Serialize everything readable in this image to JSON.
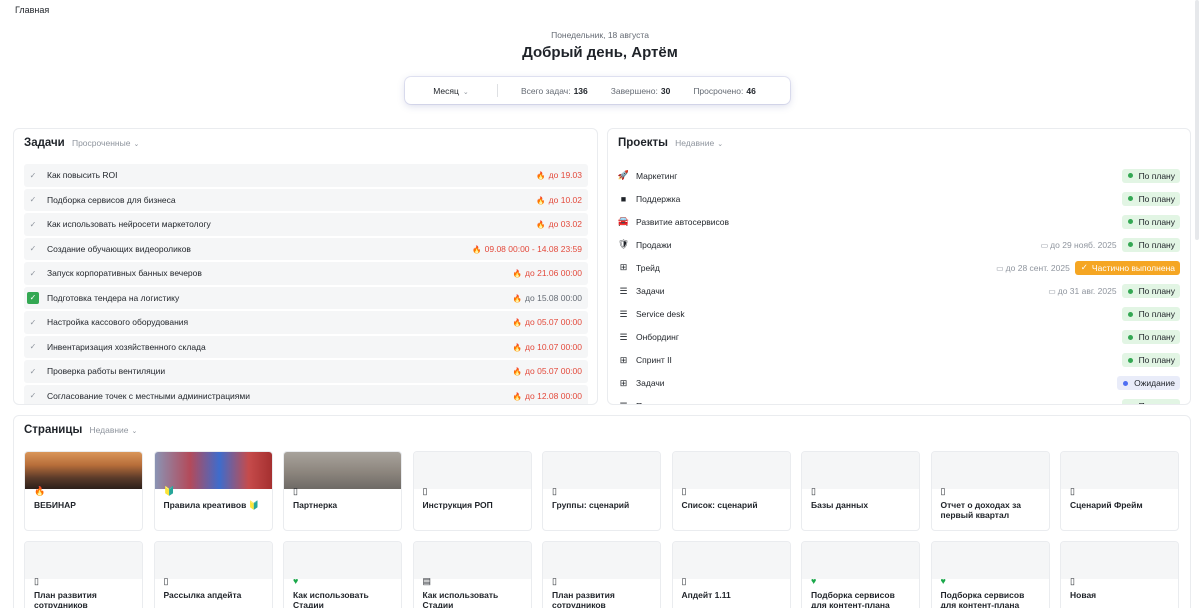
{
  "breadcrumb": "Главная",
  "header": {
    "date": "Понедельник, 18 августа",
    "greeting": "Добрый день, Артём"
  },
  "stats": {
    "period": "Месяц",
    "total_label": "Всего задач:",
    "total_value": "136",
    "done_label": "Завершено:",
    "done_value": "30",
    "overdue_label": "Просрочено:",
    "overdue_value": "46"
  },
  "tasks": {
    "title": "Задачи",
    "filter": "Просроченные",
    "items": [
      {
        "name": "Как повысить ROI",
        "due": "до 19.03",
        "done": false,
        "color": "#e3493b"
      },
      {
        "name": "Подборка сервисов для бизнеса",
        "due": "до 10.02",
        "done": false,
        "color": "#e3493b"
      },
      {
        "name": "Как использовать нейросети маркетологу",
        "due": "до 03.02",
        "done": false,
        "color": "#e3493b"
      },
      {
        "name": "Создание обучающих видеороликов",
        "due": "09.08 00:00 - 14.08 23:59",
        "done": false,
        "color": "#e3493b"
      },
      {
        "name": "Запуск корпоративных банных вечеров",
        "due": "до 21.06 00:00",
        "done": false,
        "color": "#e3493b"
      },
      {
        "name": "Подготовка тендера на логистику",
        "due": "до 15.08 00:00",
        "done": true,
        "color": "#646a73"
      },
      {
        "name": "Настройка кассового оборудования",
        "due": "до 05.07 00:00",
        "done": false,
        "color": "#e3493b"
      },
      {
        "name": "Инвентаризация хозяйственного склада",
        "due": "до 10.07 00:00",
        "done": false,
        "color": "#e3493b"
      },
      {
        "name": "Проверка работы вентиляции",
        "due": "до 05.07 00:00",
        "done": false,
        "color": "#e3493b"
      },
      {
        "name": "Согласование точек с местными администрациями",
        "due": "до 12.08 00:00",
        "done": false,
        "color": "#e3493b"
      }
    ]
  },
  "projects": {
    "title": "Проекты",
    "filter": "Недавние",
    "items": [
      {
        "icon": "rocket-icon",
        "glyph": "🚀",
        "name": "Маркетинг",
        "date": "",
        "status": "По плану",
        "kind": "ok"
      },
      {
        "icon": "support-icon",
        "glyph": "■",
        "name": "Поддержка",
        "date": "",
        "status": "По плану",
        "kind": "ok"
      },
      {
        "icon": "car-icon",
        "glyph": "🚘",
        "name": "Развитие автосервисов",
        "date": "",
        "status": "По плану",
        "kind": "ok"
      },
      {
        "icon": "shield-icon",
        "glyph": "🛡",
        "name": "Продажи",
        "date": "до 29 нояб. 2025",
        "status": "По плану",
        "kind": "ok"
      },
      {
        "icon": "kanban-icon",
        "glyph": "⊞",
        "name": "Трейд",
        "date": "до 28 сент. 2025",
        "status": "Частично выполнена",
        "kind": "partial"
      },
      {
        "icon": "list-icon",
        "glyph": "☰",
        "name": "Задачи",
        "date": "до 31 авг. 2025",
        "status": "По плану",
        "kind": "ok"
      },
      {
        "icon": "list-icon",
        "glyph": "☰",
        "name": "Service desk",
        "date": "",
        "status": "По плану",
        "kind": "ok"
      },
      {
        "icon": "list-icon",
        "glyph": "☰",
        "name": "Онбординг",
        "date": "",
        "status": "По плану",
        "kind": "ok"
      },
      {
        "icon": "kanban-icon",
        "glyph": "⊞",
        "name": "Спринт II",
        "date": "",
        "status": "По плану",
        "kind": "ok"
      },
      {
        "icon": "kanban-icon",
        "glyph": "⊞",
        "name": "Задачи",
        "date": "",
        "status": "Ожидание",
        "kind": "wait"
      },
      {
        "icon": "list-icon",
        "glyph": "☰",
        "name": "Проектные документы",
        "date": "",
        "status": "По плану",
        "kind": "ok"
      }
    ]
  },
  "pages": {
    "title": "Страницы",
    "filter": "Недавние",
    "items": [
      {
        "title": "ВЕБИНАР",
        "cover": "mountains",
        "emoji": "🔥",
        "emoji_kind": "doc"
      },
      {
        "title": "Правила креативов 🔰",
        "cover": "expo",
        "emoji": "🔰",
        "emoji_kind": "doc"
      },
      {
        "title": "Партнерка",
        "cover": "hands",
        "emoji": "▯",
        "emoji_kind": "doc"
      },
      {
        "title": "Инструкция РОП",
        "cover": "",
        "emoji": "▯",
        "emoji_kind": "doc"
      },
      {
        "title": "Группы: сценарий",
        "cover": "",
        "emoji": "▯",
        "emoji_kind": "doc"
      },
      {
        "title": "Список: сценарий",
        "cover": "",
        "emoji": "▯",
        "emoji_kind": "doc"
      },
      {
        "title": "Базы данных",
        "cover": "",
        "emoji": "▯",
        "emoji_kind": "doc"
      },
      {
        "title": "Отчет о доходах за первый квартал",
        "cover": "",
        "emoji": "▯",
        "emoji_kind": "doc"
      },
      {
        "title": "Сценарий Фрейм",
        "cover": "",
        "emoji": "▯",
        "emoji_kind": "doc"
      },
      {
        "title": "План развития сотрудников",
        "cover": "",
        "emoji": "▯",
        "emoji_kind": "doc"
      },
      {
        "title": "Рассылка апдейта",
        "cover": "",
        "emoji": "▯",
        "emoji_kind": "doc"
      },
      {
        "title": "Как использовать Стадии",
        "cover": "",
        "emoji": "♥",
        "emoji_kind": "heart"
      },
      {
        "title": "Как использовать Стадии",
        "cover": "",
        "emoji": "▤",
        "emoji_kind": "doc"
      },
      {
        "title": "План развития сотрудников",
        "cover": "",
        "emoji": "▯",
        "emoji_kind": "doc"
      },
      {
        "title": "Апдейт 1.11",
        "cover": "",
        "emoji": "▯",
        "emoji_kind": "doc"
      },
      {
        "title": "Подборка сервисов для контент-плана",
        "cover": "",
        "emoji": "♥",
        "emoji_kind": "heart"
      },
      {
        "title": "Подборка сервисов для контент-плана (Копия)",
        "cover": "",
        "emoji": "♥",
        "emoji_kind": "heart"
      },
      {
        "title": "Новая",
        "cover": "",
        "emoji": "▯",
        "emoji_kind": "doc"
      }
    ]
  }
}
